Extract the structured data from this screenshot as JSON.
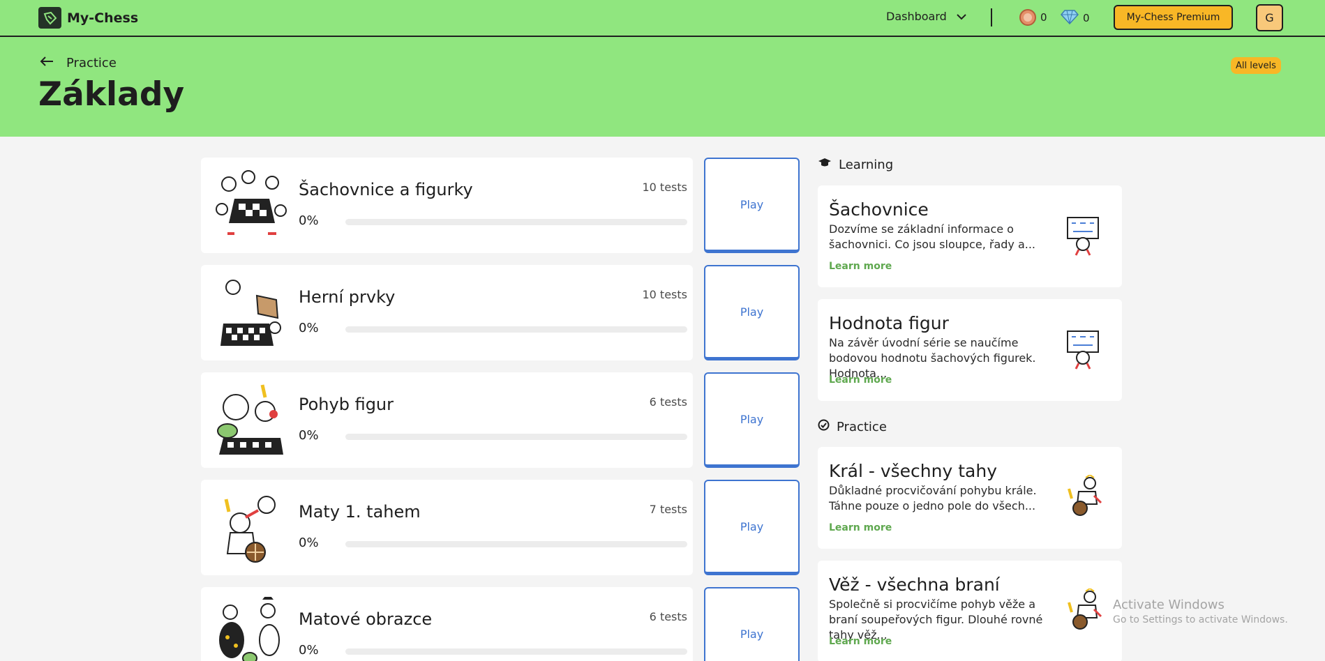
{
  "app": {
    "name": "My-Chess"
  },
  "topbar": {
    "dashboard_label": "Dashboard",
    "coins": "0",
    "gems": "0",
    "premium_label": "My-Chess Premium",
    "avatar_initial": "G"
  },
  "header": {
    "back_label": "Practice",
    "title": "Základy",
    "levels_label": "All levels"
  },
  "lessons": [
    {
      "name": "Šachovnice a figurky",
      "tests": "10 tests",
      "progress": "0%",
      "progress_value": 0,
      "play_label": "Play"
    },
    {
      "name": "Herní prvky",
      "tests": "10 tests",
      "progress": "0%",
      "progress_value": 0,
      "play_label": "Play"
    },
    {
      "name": "Pohyb figur",
      "tests": "6 tests",
      "progress": "0%",
      "progress_value": 0,
      "play_label": "Play"
    },
    {
      "name": "Maty 1. tahem",
      "tests": "7 tests",
      "progress": "0%",
      "progress_value": 0,
      "play_label": "Play"
    },
    {
      "name": "Matové obrazce",
      "tests": "6 tests",
      "progress": "0%",
      "progress_value": 0,
      "play_label": "Play"
    }
  ],
  "learning": {
    "heading": "Learning",
    "items": [
      {
        "title": "Šachovnice",
        "desc": "Dozvíme se základní informace o šachovnici. Co jsou sloupce, řady a...",
        "more": "Learn more"
      },
      {
        "title": "Hodnota figur",
        "desc": "Na závěr úvodní série se naučíme bodovou hodnotu šachových figurek. Hodnota...",
        "more": "Learn more"
      }
    ]
  },
  "practice": {
    "heading": "Practice",
    "items": [
      {
        "title": "Král - všechny tahy",
        "desc": "Důkladné procvičování pohybu krále. Táhne pouze o jedno pole do všech...",
        "more": "Learn more"
      },
      {
        "title": "Věž - všechna braní",
        "desc": "Společně si procvičíme pohyb věže a braní soupeřových figur. Dlouhé rovné tahy věž...",
        "more": "Learn more"
      }
    ]
  },
  "watermark": {
    "line1": "Activate Windows",
    "line2": "Go to Settings to activate Windows."
  },
  "colors": {
    "green": "#90e67f",
    "accent_blue": "#3e74d0",
    "premium_yellow": "#f8b726",
    "learn_more_green": "#5fa84f"
  }
}
